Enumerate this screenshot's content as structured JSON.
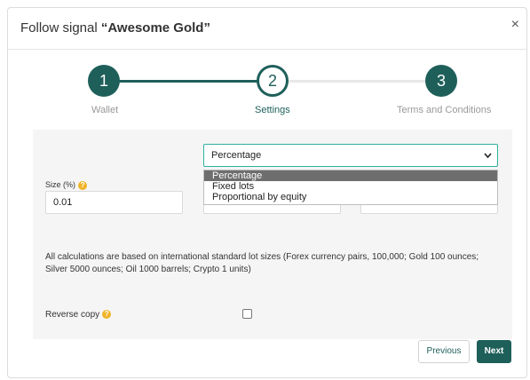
{
  "modal": {
    "title_prefix": "Follow signal ",
    "title_name": "“Awesome Gold”",
    "close_label": "×"
  },
  "stepper": {
    "steps": [
      {
        "number": "1",
        "label": "Wallet"
      },
      {
        "number": "2",
        "label": "Settings"
      },
      {
        "number": "3",
        "label": "Terms and Conditions"
      }
    ],
    "active_step": 2
  },
  "settings": {
    "mode_select": {
      "value": "Percentage",
      "options": [
        "Percentage",
        "Fixed lots",
        "Proportional by equity"
      ],
      "highlighted": "Percentage"
    },
    "size": {
      "label": "Size (%)",
      "value": "0.01"
    },
    "note": "All calculations are based on international standard lot sizes (Forex currency pairs, 100,000; Gold 100 ounces; Silver 5000 ounces; Oil 1000 barrels; Crypto 1 units)",
    "reverse_copy": {
      "label": "Reverse copy",
      "checked": false
    }
  },
  "buttons": {
    "previous": "Previous",
    "next": "Next"
  },
  "colors": {
    "primary": "#1e5f5a",
    "focus_border": "#2fb09f",
    "help_icon": "#f0b429",
    "panel_bg": "#f5f5f5"
  },
  "icons": {
    "help": "question-circle-icon",
    "close": "close-icon",
    "dropdown": "chevron-down-icon"
  }
}
